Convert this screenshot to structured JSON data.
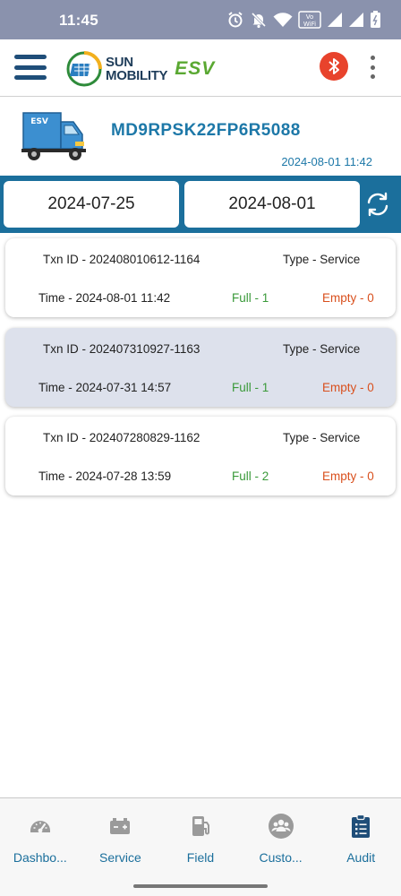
{
  "status_bar": {
    "time": "11:45",
    "icons": [
      "alarm-icon",
      "mute-icon",
      "wifi-icon",
      "vowifi-icon",
      "signal-icon",
      "signal-icon",
      "battery-icon"
    ]
  },
  "app_bar": {
    "brand_line1": "SUN",
    "brand_line2": "MOBILITY",
    "brand_product": "ESV",
    "bluetooth_color": "#e8432c"
  },
  "vehicle": {
    "badge": "ESV",
    "id": "MD9RPSK22FP6R5088",
    "timestamp": "2024-08-01 11:42"
  },
  "filter": {
    "from_date": "2024-07-25",
    "to_date": "2024-08-01"
  },
  "transactions": [
    {
      "txn_id": "Txn ID - 202408010612-1164",
      "type": "Type - Service",
      "time": "Time - 2024-08-01 11:42",
      "full": "Full - 1",
      "empty": "Empty - 0",
      "selected": false
    },
    {
      "txn_id": "Txn ID - 202407310927-1163",
      "type": "Type - Service",
      "time": "Time - 2024-07-31 14:57",
      "full": "Full - 1",
      "empty": "Empty - 0",
      "selected": true
    },
    {
      "txn_id": "Txn ID - 202407280829-1162",
      "type": "Type - Service",
      "time": "Time - 2024-07-28 13:59",
      "full": "Full - 2",
      "empty": "Empty - 0",
      "selected": false
    }
  ],
  "bottom_nav": [
    {
      "label": "Dashbo...",
      "icon": "speedometer-icon",
      "active": false
    },
    {
      "label": "Service",
      "icon": "battery-swap-icon",
      "active": false
    },
    {
      "label": "Field",
      "icon": "fuel-pump-icon",
      "active": false
    },
    {
      "label": "Custo...",
      "icon": "customers-icon",
      "active": false
    },
    {
      "label": "Audit",
      "icon": "clipboard-list-icon",
      "active": true
    }
  ],
  "colors": {
    "primary": "#1b6f9c",
    "full": "#3a9a3a",
    "empty": "#d9501e",
    "selected_card": "#dde1ec"
  }
}
